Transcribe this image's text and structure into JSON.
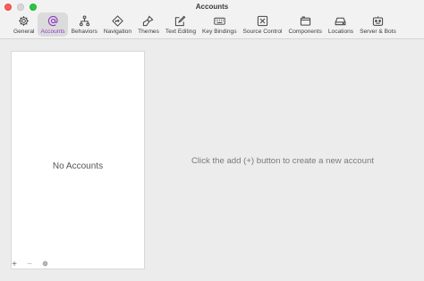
{
  "window": {
    "title": "Accounts"
  },
  "toolbar": {
    "items": [
      {
        "label": "General",
        "icon": "gear-icon"
      },
      {
        "label": "Accounts",
        "icon": "at-sign-icon",
        "selected": true
      },
      {
        "label": "Behaviors",
        "icon": "hierarchy-icon"
      },
      {
        "label": "Navigation",
        "icon": "navigation-diamond-icon"
      },
      {
        "label": "Themes",
        "icon": "paintbrush-icon"
      },
      {
        "label": "Text Editing",
        "icon": "pencil-square-icon"
      },
      {
        "label": "Key Bindings",
        "icon": "keyboard-icon"
      },
      {
        "label": "Source Control",
        "icon": "source-control-icon"
      },
      {
        "label": "Components",
        "icon": "components-icon"
      },
      {
        "label": "Locations",
        "icon": "disk-drive-icon"
      },
      {
        "label": "Server & Bots",
        "icon": "server-bot-icon"
      }
    ],
    "accent_color": "#8e3bbd"
  },
  "accounts_panel": {
    "empty_label": "No Accounts",
    "controls": {
      "add": "+",
      "remove": "−"
    }
  },
  "detail": {
    "hint": "Click the add (+) button to create a new account"
  }
}
